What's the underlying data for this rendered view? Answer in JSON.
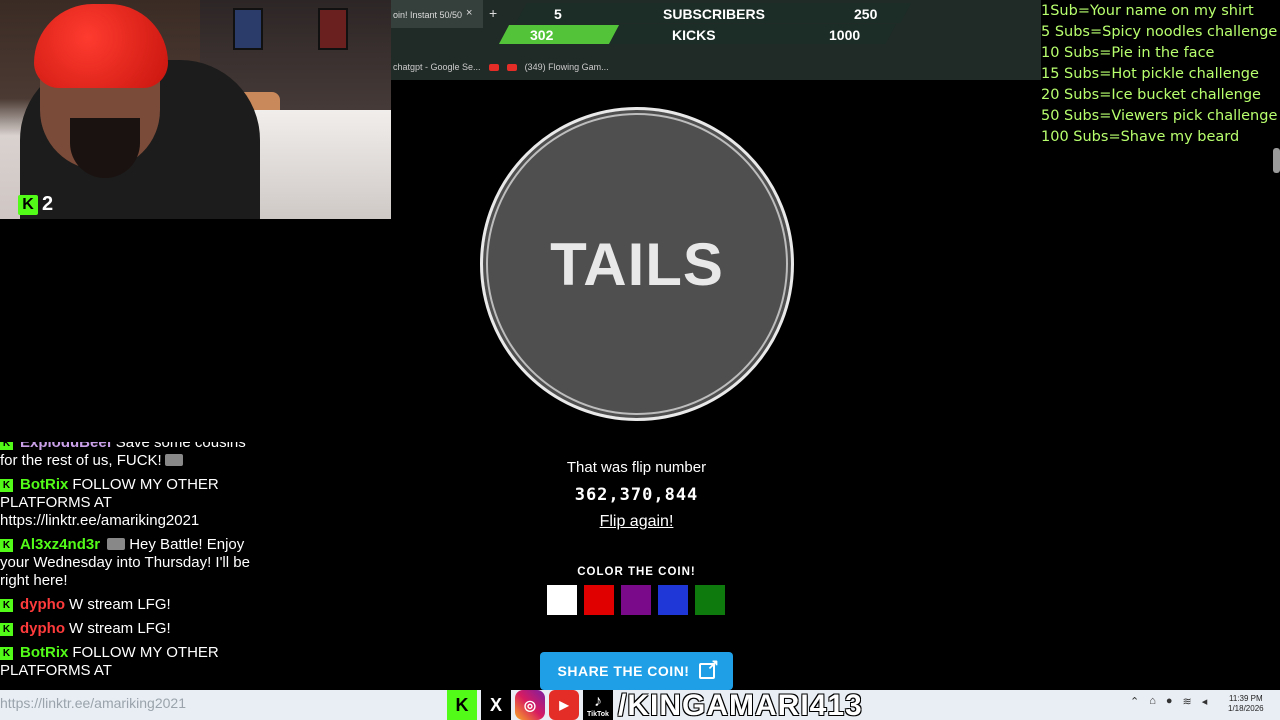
{
  "stream": {
    "viewer_count": "2"
  },
  "browser": {
    "tab_title": "oin! Instant 50/50",
    "tab_close": "×",
    "new_tab": "+",
    "bookmarks": [
      "chatgpt - Google Se...",
      "",
      "(349) Flowing Gam..."
    ]
  },
  "counters": {
    "subs_current": "5",
    "subs_label": "SUBSCRIBERS",
    "subs_goal": "250",
    "kicks_current": "302",
    "kicks_label": "KICKS",
    "kicks_goal": "1000"
  },
  "goals": [
    "1Sub=Your name on my shirt",
    "5 Subs=Spicy noodles challenge",
    "10 Subs=Pie in the face",
    "15 Subs=Hot pickle challenge",
    "20 Subs=Ice bucket challenge",
    "50 Subs=Viewers pick challenge",
    "100 Subs=Shave my beard"
  ],
  "coin": {
    "result": "TAILS",
    "flip_label": "That was flip number",
    "flip_number": "362,370,844",
    "flip_again": "Flip again!",
    "color_label": "COLOR THE COIN!",
    "swatches": [
      "#ffffff",
      "#e00000",
      "#7a0a8a",
      "#1f37d6",
      "#0e7a0e"
    ],
    "share_label": "SHARE THE COIN!"
  },
  "chat": [
    {
      "user": "ExploduBeef",
      "color": "#c9a0e8",
      "text": "Save some cousins for the rest of us, FUCK!"
    },
    {
      "user": "BotRix",
      "color": "#53fc18",
      "text": "FOLLOW MY OTHER PLATFORMS AT https://linktr.ee/amariking2021"
    },
    {
      "user": "Al3xz4nd3r",
      "color": "#53fc18",
      "text": "Hey Battle! Enjoy your Wednesday into Thursday! I'll be right here!"
    },
    {
      "user": "dypho",
      "color": "#ff3b3b",
      "text": "W stream LFG!"
    },
    {
      "user": "dypho",
      "color": "#ff3b3b",
      "text": "W stream LFG!"
    },
    {
      "user": "BotRix",
      "color": "#53fc18",
      "text": "FOLLOW MY OTHER PLATFORMS AT"
    }
  ],
  "taskbar": {
    "link_text": "https://linktr.ee/amariking2021",
    "handle": "/KINGAMARI413",
    "time": "11:39 PM",
    "date": "1/18/2026",
    "tiktok_label": "TikTok"
  }
}
